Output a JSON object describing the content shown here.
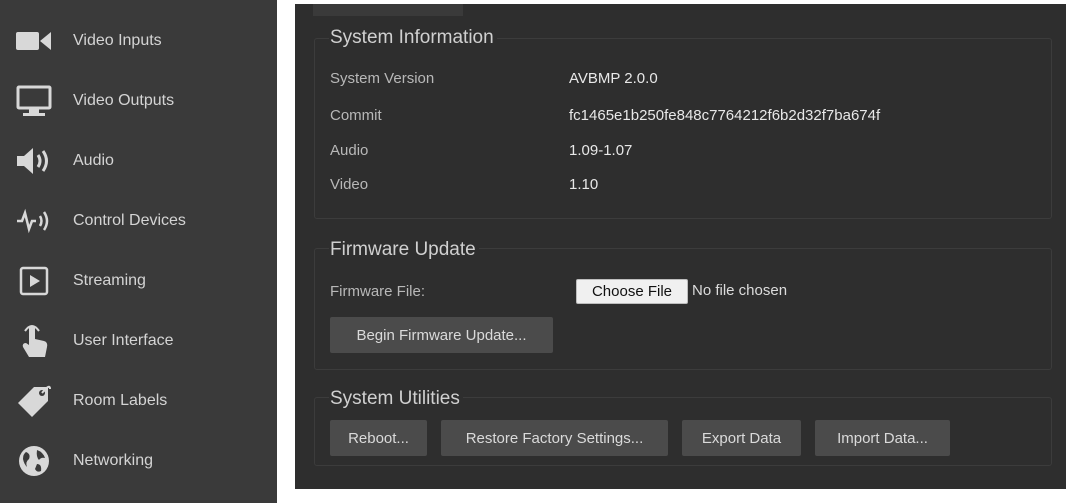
{
  "sidebar": {
    "items": [
      {
        "label": "Video Inputs",
        "icon": "video-camera-icon"
      },
      {
        "label": "Video Outputs",
        "icon": "monitor-icon"
      },
      {
        "label": "Audio",
        "icon": "speaker-icon"
      },
      {
        "label": "Control Devices",
        "icon": "control-signal-icon"
      },
      {
        "label": "Streaming",
        "icon": "play-icon"
      },
      {
        "label": "User Interface",
        "icon": "touch-hand-icon"
      },
      {
        "label": "Room Labels",
        "icon": "tag-icon"
      },
      {
        "label": "Networking",
        "icon": "globe-icon"
      }
    ]
  },
  "system_information": {
    "title": "System Information",
    "rows": [
      {
        "label": "System Version",
        "value": "AVBMP 2.0.0"
      },
      {
        "label": "Commit",
        "value": "fc1465e1b250fe848c7764212f6b2d32f7ba674f"
      },
      {
        "label": "Audio",
        "value": "1.09-1.07"
      },
      {
        "label": "Video",
        "value": "1.10"
      }
    ]
  },
  "firmware_update": {
    "title": "Firmware Update",
    "file_label": "Firmware File:",
    "choose_file_label": "Choose File",
    "file_status": "No file chosen",
    "begin_button": "Begin Firmware Update..."
  },
  "system_utilities": {
    "title": "System Utilities",
    "buttons": [
      "Reboot...",
      "Restore Factory Settings...",
      "Export Data",
      "Import Data..."
    ]
  },
  "colors": {
    "sidebar_bg": "#3a3a3a",
    "main_bg": "#2e2e2e",
    "button_bg": "#4b4b4b"
  }
}
